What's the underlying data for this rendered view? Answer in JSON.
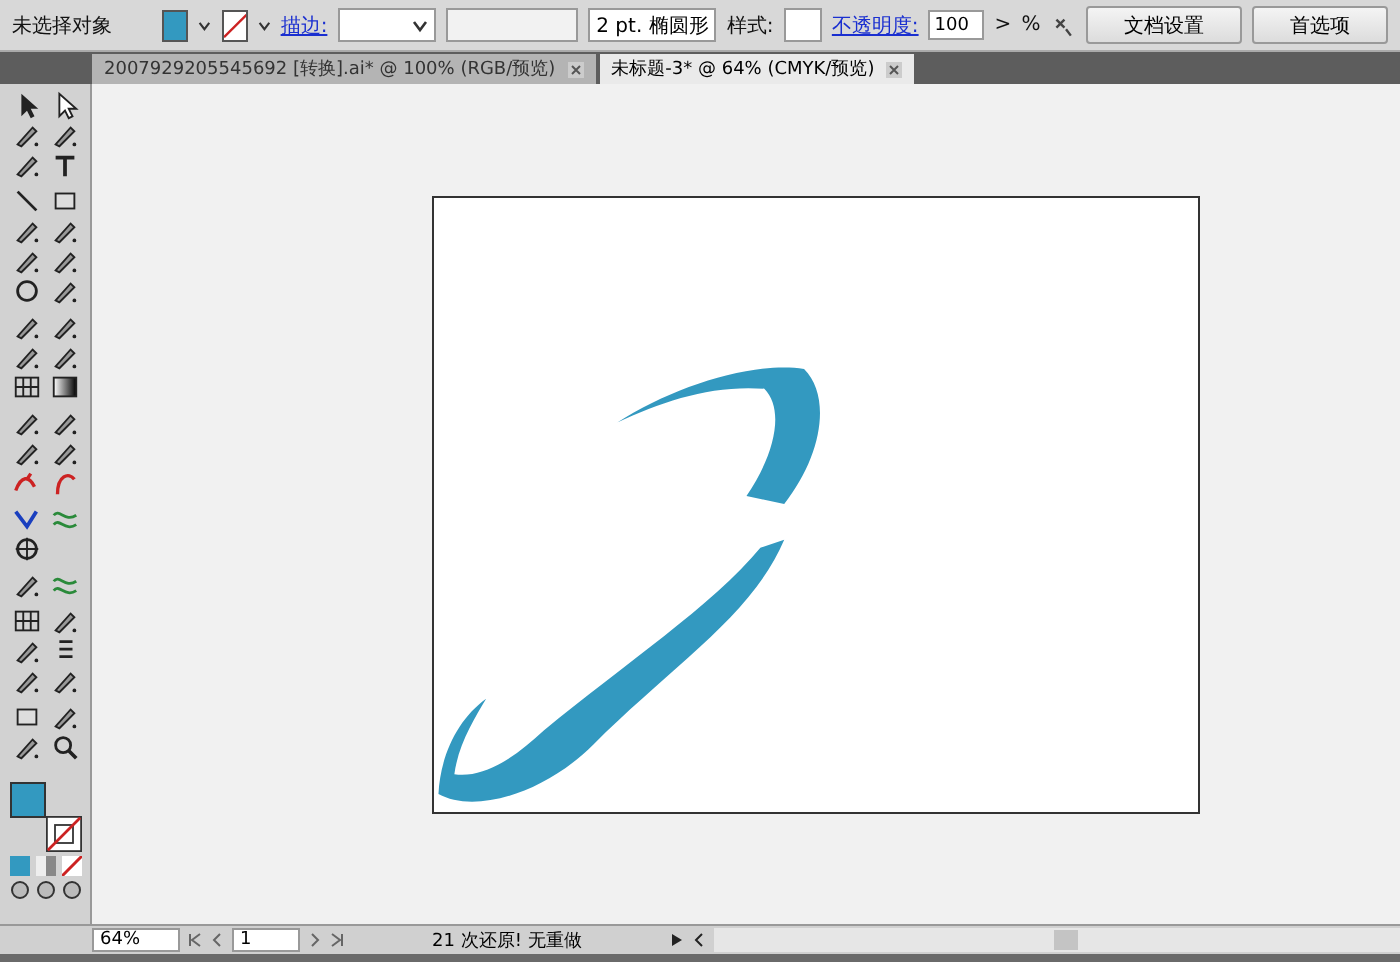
{
  "control_bar": {
    "selection_label": "未选择对象",
    "stroke_link": "描边:",
    "brush_value": "2 pt. 椭圆形",
    "style_label": "样式:",
    "opacity_link": "不透明度:",
    "opacity_value": "100",
    "opacity_arrow": ">",
    "percent": "%",
    "buttons": [
      "文档设置",
      "首选项"
    ]
  },
  "tabs": [
    {
      "label": "2007929205545692 [转换].ai* @ 100% (RGB/预览)",
      "selected": false
    },
    {
      "label": "未标题-3* @ 64% (CMYK/预览)",
      "selected": true
    }
  ],
  "status_bar": {
    "zoom": "64%",
    "page": "1",
    "message": "21 次还原! 无重做"
  }
}
